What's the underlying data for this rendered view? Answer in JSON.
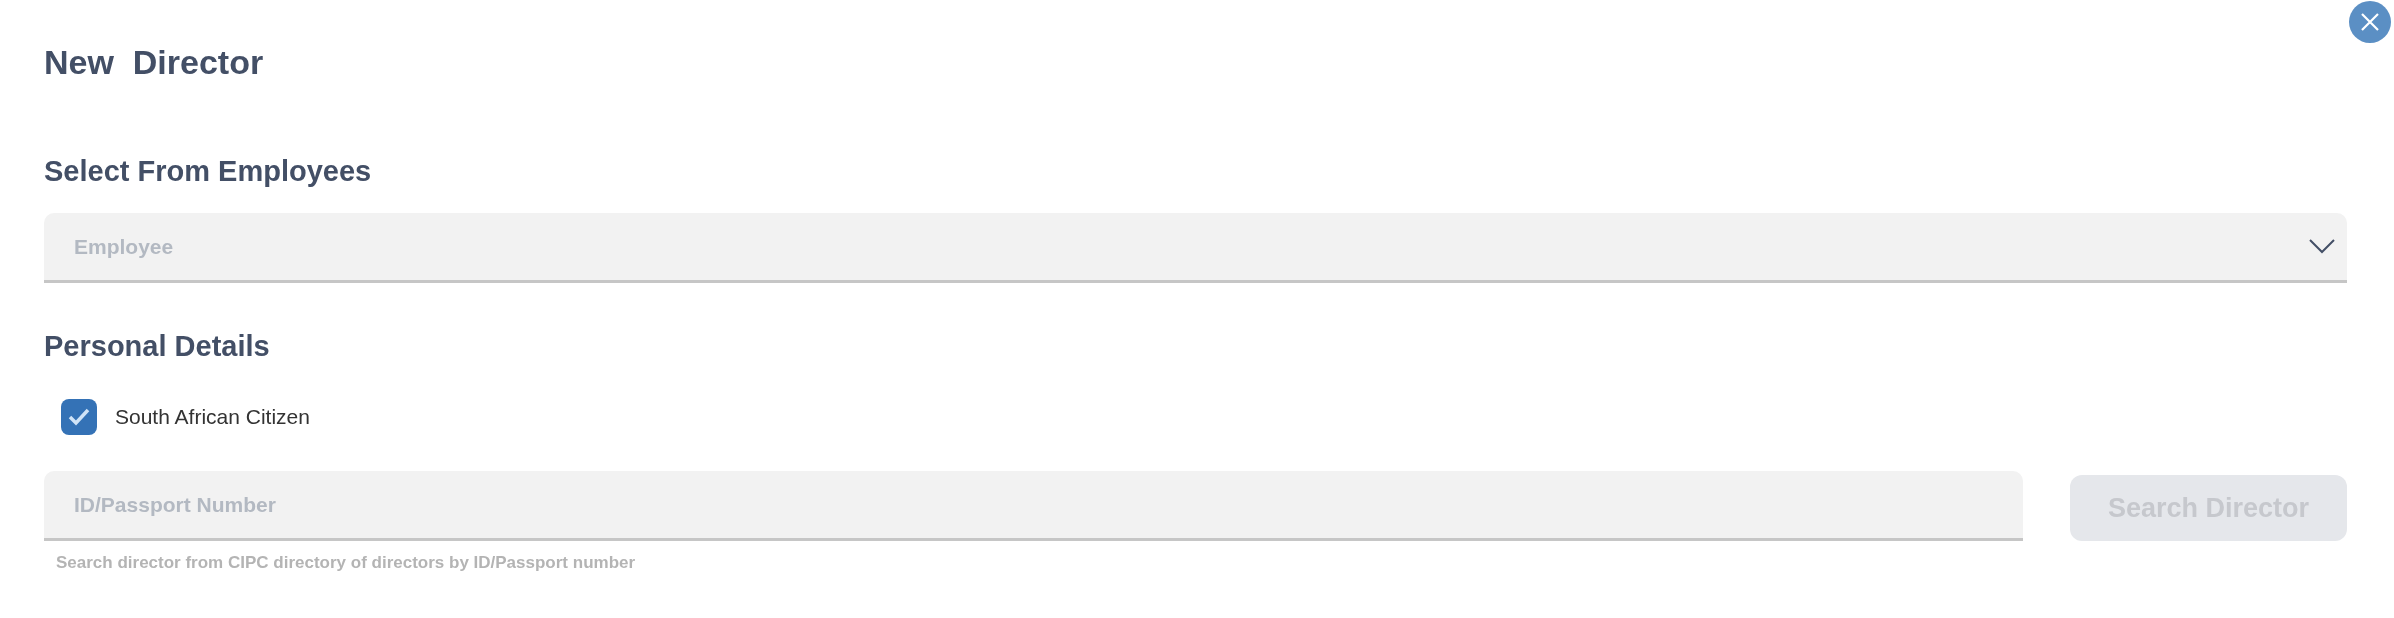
{
  "title": "New  Director",
  "employee_section": {
    "heading": "Select From Employees",
    "dropdown": {
      "placeholder": "Employee"
    }
  },
  "personal_section": {
    "heading": "Personal Details",
    "citizen_checkbox": {
      "label": "South African Citizen",
      "checked": true
    },
    "id_field": {
      "placeholder": "ID/Passport Number",
      "hint": "Search director from CIPC directory of directors by ID/Passport number"
    },
    "search_button": {
      "label": "Search Director",
      "disabled": true
    }
  }
}
